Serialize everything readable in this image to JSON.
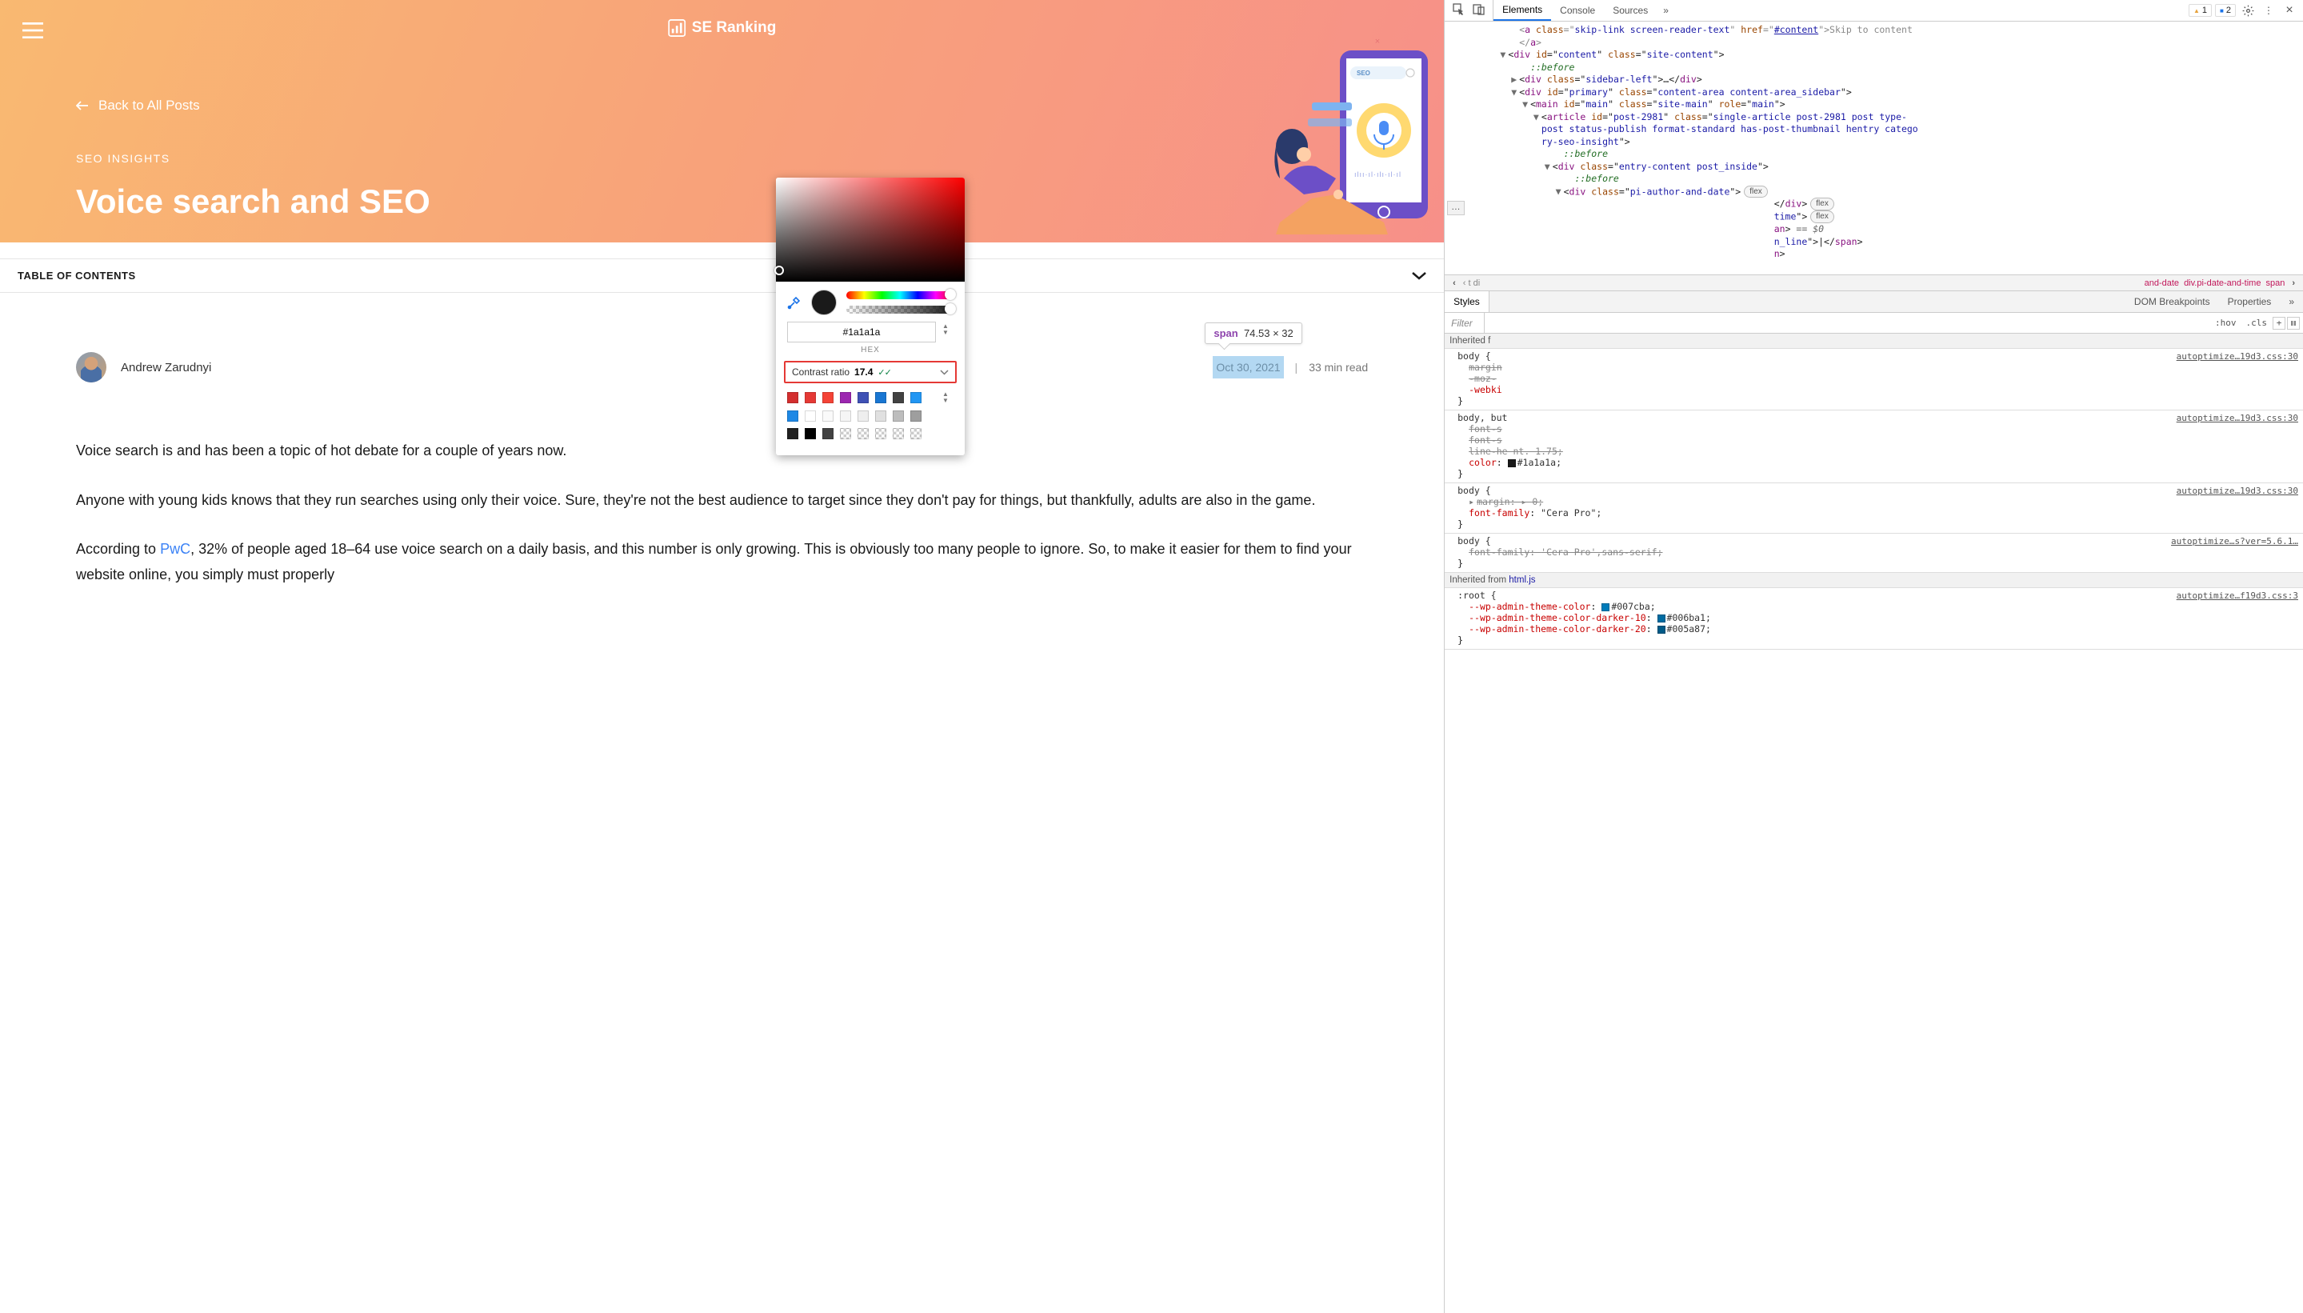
{
  "webpage": {
    "logo_text": "SE Ranking",
    "back_link": "Back to All Posts",
    "category": "SEO INSIGHTS",
    "title": "Voice search and SEO",
    "illustration_seo_label": "SEO",
    "toc_label": "TABLE OF CONTENTS",
    "author": "Andrew Zarudnyi",
    "post_date": "Oct 30, 2021",
    "read_time": "33 min read",
    "divider": "|",
    "tooltip_tag": "span",
    "tooltip_dims": "74.53 × 32",
    "paragraphs": [
      "Voice search is and has been a topic of hot debate for a couple of years now.",
      "Anyone with young kids knows that they run searches using only their voice. Sure, they're not the best audience to target since they don't pay for things, but thankfully, adults are also in the game."
    ],
    "p3_prefix": "According to ",
    "p3_link": "PwC",
    "p3_rest": ", 32% of people aged 18–64 use voice search on a daily basis, and this number is only growing. This is obviously too many people to ignore. So, to make it easier for them to find your website online, you simply must properly"
  },
  "devtools": {
    "tabs": [
      "Elements",
      "Console",
      "Sources"
    ],
    "more": "»",
    "badge_warn": "1",
    "badge_info": "2",
    "dom_lines": [
      {
        "indent": 5,
        "html": "<span class='dim'>&lt;<span class='tag-name'>a</span> <span class='attr-name'>class</span>=\"<span class='attr-val'>skip-link screen-reader-text</span>\" <span class='attr-name'>href</span>=\"<span class='attr-link'>#content</span>\"&gt;Skip to content</span>"
      },
      {
        "indent": 5,
        "html": "<span class='dim'>&lt;/<span class='tag-name'>a</span>&gt;</span>"
      },
      {
        "indent": 4,
        "arrow": "▼",
        "html": "&lt;<span class='tag-name'>div</span> <span class='attr-name'>id</span>=\"<span class='attr-val'>content</span>\" <span class='attr-name'>class</span>=\"<span class='attr-val'>site-content</span>\"&gt;"
      },
      {
        "indent": 6,
        "html": "<span class='pseudo'>::before</span>"
      },
      {
        "indent": 5,
        "arrow": "▶",
        "html": "&lt;<span class='tag-name'>div</span> <span class='attr-name'>class</span>=\"<span class='attr-val'>sidebar-left</span>\"&gt;…&lt;/<span class='tag-name'>div</span>&gt;"
      },
      {
        "indent": 5,
        "arrow": "▼",
        "html": "&lt;<span class='tag-name'>div</span> <span class='attr-name'>id</span>=\"<span class='attr-val'>primary</span>\" <span class='attr-name'>class</span>=\"<span class='attr-val'>content-area content-area_sidebar</span>\"&gt;"
      },
      {
        "indent": 6,
        "arrow": "▼",
        "html": "&lt;<span class='tag-name'>main</span> <span class='attr-name'>id</span>=\"<span class='attr-val'>main</span>\" <span class='attr-name'>class</span>=\"<span class='attr-val'>site-main</span>\" <span class='attr-name'>role</span>=\"<span class='attr-val'>main</span>\"&gt;"
      },
      {
        "indent": 7,
        "arrow": "▼",
        "html": "&lt;<span class='tag-name'>article</span> <span class='attr-name'>id</span>=\"<span class='attr-val'>post-2981</span>\" <span class='attr-name'>class</span>=\"<span class='attr-val'>single-article post-2981 post type-</span>"
      },
      {
        "indent": 7,
        "html": "<span class='attr-val'>post status-publish format-standard has-post-thumbnail hentry catego</span>"
      },
      {
        "indent": 7,
        "html": "<span class='attr-val'>ry-seo-insight</span>\"&gt;"
      },
      {
        "indent": 9,
        "html": "<span class='pseudo'>::before</span>"
      },
      {
        "indent": 8,
        "arrow": "▼",
        "html": "&lt;<span class='tag-name'>div</span> <span class='attr-name'>class</span>=\"<span class='attr-val'>entry-content post_inside</span>\"&gt;"
      },
      {
        "indent": 10,
        "html": "<span class='pseudo'>::before</span>"
      },
      {
        "indent": 9,
        "arrow": "▼",
        "html": "&lt;<span class='tag-name'>div</span> <span class='attr-name'>class</span>=\"<span class='attr-val'>pi-author-and-date</span>\"&gt;<span class='pill'>flex</span>"
      },
      {
        "indent": 28,
        "html": "&lt;/<span class='tag-name'>div</span>&gt;<span class='pill'>flex</span>"
      },
      {
        "indent": 28,
        "html": "<span class='attr-val'>time</span>\"&gt;<span class='pill'>flex</span>"
      },
      {
        "indent": 28,
        "html": "<span class='tag-name'>an</span>&gt; <span class='eqvar'>== $0</span>"
      },
      {
        "indent": 28,
        "html": "<span class='attr-val'>n_line</span>\"&gt;|&lt;/<span class='tag-name'>span</span>&gt;"
      },
      {
        "indent": 28,
        "html": "<span class='tag-name'>n</span>&gt;"
      }
    ],
    "crumbs_hidden_left": "‹ t   di",
    "crumbs": [
      "and-date",
      "div.pi-date-and-time",
      "span"
    ],
    "crumbs_right_arrow": "›",
    "styles_tabs": [
      "Styles",
      "DOM Breakpoints",
      "Properties"
    ],
    "styles_more": "»",
    "filter_placeholder": "Filter",
    "filter_tools": {
      "hov": ":hov",
      "cls": ".cls",
      "plus": "+"
    },
    "inherited_from_label": "Inherited f",
    "inherited_from_html_label": "Inherited from ",
    "inherited_from_html_tag": "html.js",
    "source_link": "autoptimize…19d3.css:30",
    "source_link_2": "autoptimize…s?ver=5.6.1…",
    "source_link_3": "autoptimize…f19d3.css:3",
    "rules": [
      {
        "selector": "body {",
        "source": "autoptimize…19d3.css:30",
        "lines": [
          {
            "name": "margin",
            "strike": true
          },
          {
            "name": "-moz-",
            "strike": true
          },
          {
            "name": "-webki",
            "strike": false
          }
        ],
        "close": "}"
      },
      {
        "selector": "body, but",
        "source": "autoptimize…19d3.css:30",
        "lines": [
          {
            "name": "font-s",
            "strike": true
          },
          {
            "name": "font-s",
            "strike": true
          },
          {
            "name": "line-he   nt. 1.75;",
            "strike": true
          },
          {
            "name": "color",
            "val": "#1a1a1a;",
            "swatch": "#1a1a1a",
            "strike": false
          }
        ],
        "close": "}"
      },
      {
        "selector": "body {",
        "source": "autoptimize…19d3.css:30",
        "lines": [
          {
            "name": "margin",
            "val": "▸ 0;",
            "strike": true,
            "expander": true
          },
          {
            "name": "font-family",
            "val": "\"Cera Pro\";",
            "strike": false
          }
        ],
        "close": "}"
      },
      {
        "selector": "body {",
        "source": "autoptimize…s?ver=5.6.1…",
        "lines": [
          {
            "name": "font-family",
            "val": "'Cera Pro',sans-serif;",
            "strike": true
          }
        ],
        "close": "}"
      }
    ],
    "root_rule": {
      "selector": ":root {",
      "source": "autoptimize…f19d3.css:3",
      "lines": [
        {
          "name": "--wp-admin-theme-color",
          "val": "#007cba;",
          "swatch": "#007cba"
        },
        {
          "name": "--wp-admin-theme-color-darker-10",
          "val": "#006ba1;",
          "swatch": "#006ba1"
        },
        {
          "name": "--wp-admin-theme-color-darker-20",
          "val": "#005a87;",
          "swatch": "#005a87"
        }
      ]
    }
  },
  "picker": {
    "hex": "#1a1a1a",
    "hex_label": "HEX",
    "contrast_label": "Contrast ratio",
    "contrast_value": "17.4",
    "palette_rows": [
      [
        "#d32f2f",
        "#e53935",
        "#f44336",
        "#9c27b0",
        "#3f51b5",
        "#1976d2",
        "#424242",
        "#2196f3"
      ],
      [
        "#1e88e5",
        "#ffffff",
        "#fafafa",
        "#f5f5f5",
        "#eeeeee",
        "#e0e0e0",
        "#bdbdbd",
        "#9e9e9e"
      ],
      [
        "#212121",
        "#000000",
        "#424242",
        "#checker",
        "#checker",
        "#checker",
        "#checker",
        "#checker"
      ]
    ]
  }
}
